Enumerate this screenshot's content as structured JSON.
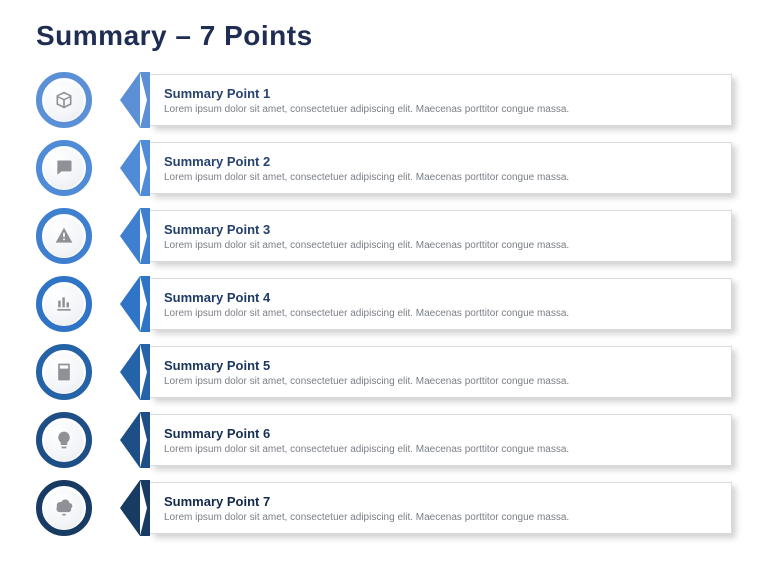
{
  "title": "Summary – 7 Points",
  "body_text": "Lorem ipsum dolor sit amet, consectetuer adipiscing elit. Maecenas porttitor congue massa.",
  "points": [
    {
      "label": "Summary Point 1",
      "icon": "box-icon",
      "ring": "#5b8fd6",
      "title_color": "#28436f"
    },
    {
      "label": "Summary Point 2",
      "icon": "chat-icon",
      "ring": "#4f8bd6",
      "title_color": "#27436f"
    },
    {
      "label": "Summary Point 3",
      "icon": "warning-icon",
      "ring": "#3e7fcf",
      "title_color": "#22406c"
    },
    {
      "label": "Summary Point 4",
      "icon": "bar-chart-icon",
      "ring": "#2f74c6",
      "title_color": "#1e3b67"
    },
    {
      "label": "Summary Point 5",
      "icon": "calculator-icon",
      "ring": "#2463a8",
      "title_color": "#1a355f"
    },
    {
      "label": "Summary Point 6",
      "icon": "lightbulb-icon",
      "ring": "#1d4f86",
      "title_color": "#172f54"
    },
    {
      "label": "Summary Point 7",
      "icon": "cloud-gear-icon",
      "ring": "#173b63",
      "title_color": "#13294a"
    }
  ]
}
